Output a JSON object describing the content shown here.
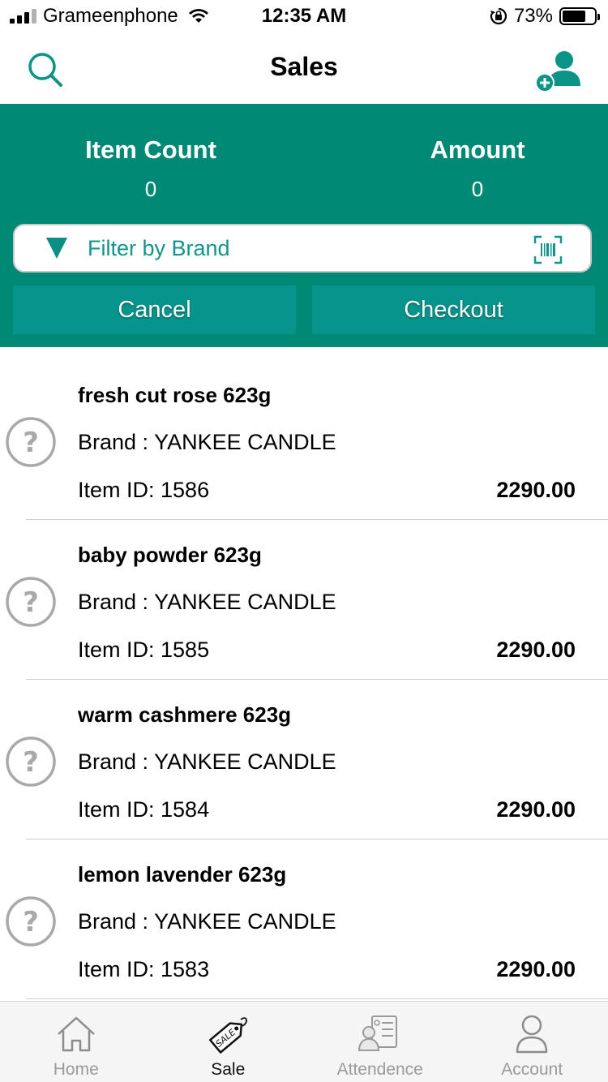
{
  "status_bar": {
    "carrier": "Grameenphone",
    "time": "12:35 AM",
    "battery_percent": "73%",
    "battery_level": 0.73,
    "icons": [
      "signal-icon",
      "wifi-icon",
      "orientation-lock-icon",
      "battery-icon"
    ]
  },
  "nav": {
    "title": "Sales",
    "left_icon": "search-icon",
    "right_icon": "add-user-icon"
  },
  "summary": {
    "item_count_label": "Item Count",
    "item_count_value": "0",
    "amount_label": "Amount",
    "amount_value": "0"
  },
  "filter": {
    "placeholder": "Filter by Brand",
    "icon": "filter-icon",
    "scan_icon": "barcode-scan-icon"
  },
  "actions": {
    "cancel": "Cancel",
    "checkout": "Checkout"
  },
  "items": [
    {
      "name": "fresh cut rose 623g",
      "brand": "Brand : YANKEE CANDLE",
      "item_id": "Item ID: 1586",
      "price": "2290.00"
    },
    {
      "name": "baby powder 623g",
      "brand": "Brand : YANKEE CANDLE",
      "item_id": "Item ID: 1585",
      "price": "2290.00"
    },
    {
      "name": "warm cashmere 623g",
      "brand": "Brand : YANKEE CANDLE",
      "item_id": "Item ID: 1584",
      "price": "2290.00"
    },
    {
      "name": "lemon lavender 623g",
      "brand": "Brand : YANKEE CANDLE",
      "item_id": "Item ID: 1583",
      "price": "2290.00"
    }
  ],
  "tabs": [
    {
      "label": "Home",
      "icon": "home-icon",
      "active": false
    },
    {
      "label": "Sale",
      "icon": "sale-tag-icon",
      "active": true
    },
    {
      "label": "Attendence",
      "icon": "attendance-icon",
      "active": false
    },
    {
      "label": "Account",
      "icon": "account-icon",
      "active": false
    }
  ],
  "colors": {
    "header_green": "#008a76",
    "button_teal": "#06948c",
    "accent_teal": "#10958a"
  }
}
